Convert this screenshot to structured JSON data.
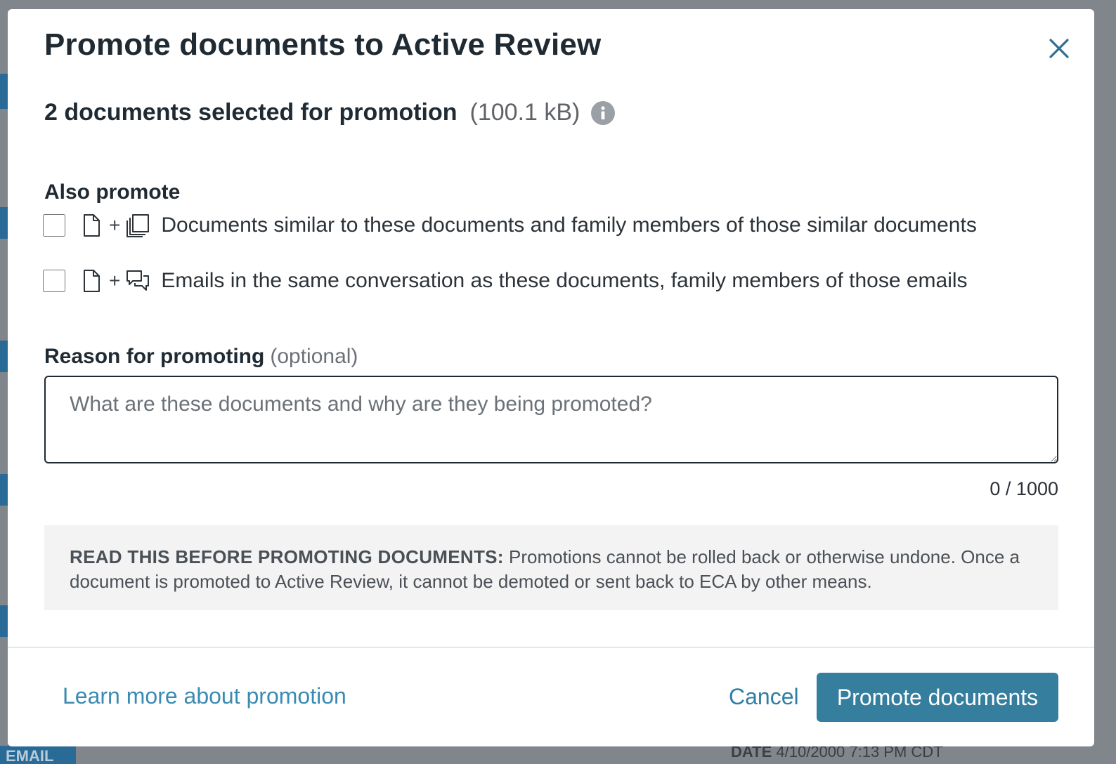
{
  "dialog": {
    "title": "Promote documents to Active Review",
    "selection": {
      "count_text": "2 documents selected for promotion",
      "size_text": "(100.1 kB)"
    },
    "also_promote": {
      "label": "Also promote",
      "options": [
        {
          "text": "Documents similar to these documents and family members of those similar documents",
          "checked": false,
          "icon": "stacked-documents-icon"
        },
        {
          "text": "Emails in the same conversation as these documents, family members of those emails",
          "checked": false,
          "icon": "conversation-icon"
        }
      ],
      "plus": "+"
    },
    "reason": {
      "label": "Reason for promoting",
      "optional": "(optional)",
      "placeholder": "What are these documents and why are they being promoted?",
      "value": "",
      "char_count": "0 / 1000"
    },
    "warning": {
      "heading": "READ THIS BEFORE PROMOTING DOCUMENTS:",
      "body": " Promotions cannot be rolled back or otherwise undone. Once a document is promoted to Active Review, it cannot be demoted or sent back to ECA by other means."
    },
    "footer": {
      "learn_more": "Learn more about promotion",
      "cancel": "Cancel",
      "promote": "Promote documents"
    }
  },
  "background": {
    "bottom_left": "EMAIL",
    "bottom_right_label": "DATE",
    "bottom_right_value": "4/10/2000 7:13 PM CDT"
  },
  "colors": {
    "overlay": "#80868b",
    "primary_button": "#357e9e",
    "link": "#3a8bb3",
    "title_text": "#1f2a33"
  }
}
